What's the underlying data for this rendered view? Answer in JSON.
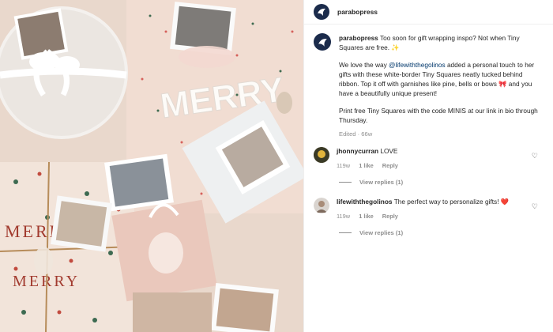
{
  "account": {
    "username": "parabopress",
    "avatar_icon": "parabo-logo-icon"
  },
  "post": {
    "caption_line1": "Too soon for gift wrapping inspo? Not when Tiny Squares are free. ✨",
    "p2_before": "We love the way ",
    "p2_mention": "@lifewiththegolinos",
    "p2_after": " added a personal touch to her gifts with these white-border Tiny Squares neatly tucked behind ribbon. Top it off with garnishes like pine, bells or bows 🎀 and you have a beautifully unique present!",
    "p3": "Print free Tiny Squares with the code MINIS at our link in bio through Thursday.",
    "meta": "Edited · 66w"
  },
  "comments": [
    {
      "username": "jhonnycurran",
      "text": "LOVE",
      "age": "119w",
      "likes": "1 like",
      "reply": "Reply",
      "view_replies": "View replies (1)",
      "heart_icon": "heart-outline-icon"
    },
    {
      "username": "lifewiththegolinos",
      "text": "The perfect way to personalize gifts! ❤️",
      "age": "119w",
      "likes": "1 like",
      "reply": "Reply",
      "view_replies": "View replies (1)",
      "heart_icon": "heart-outline-icon"
    }
  ],
  "photo": {
    "banner_text": "MERRY",
    "wrap_text_1": "MERRY",
    "wrap_text_2": "MERRY"
  },
  "colors": {
    "brand_navy": "#1b2b4b",
    "link": "#00376b",
    "meta_grey": "#8e8e8e"
  }
}
